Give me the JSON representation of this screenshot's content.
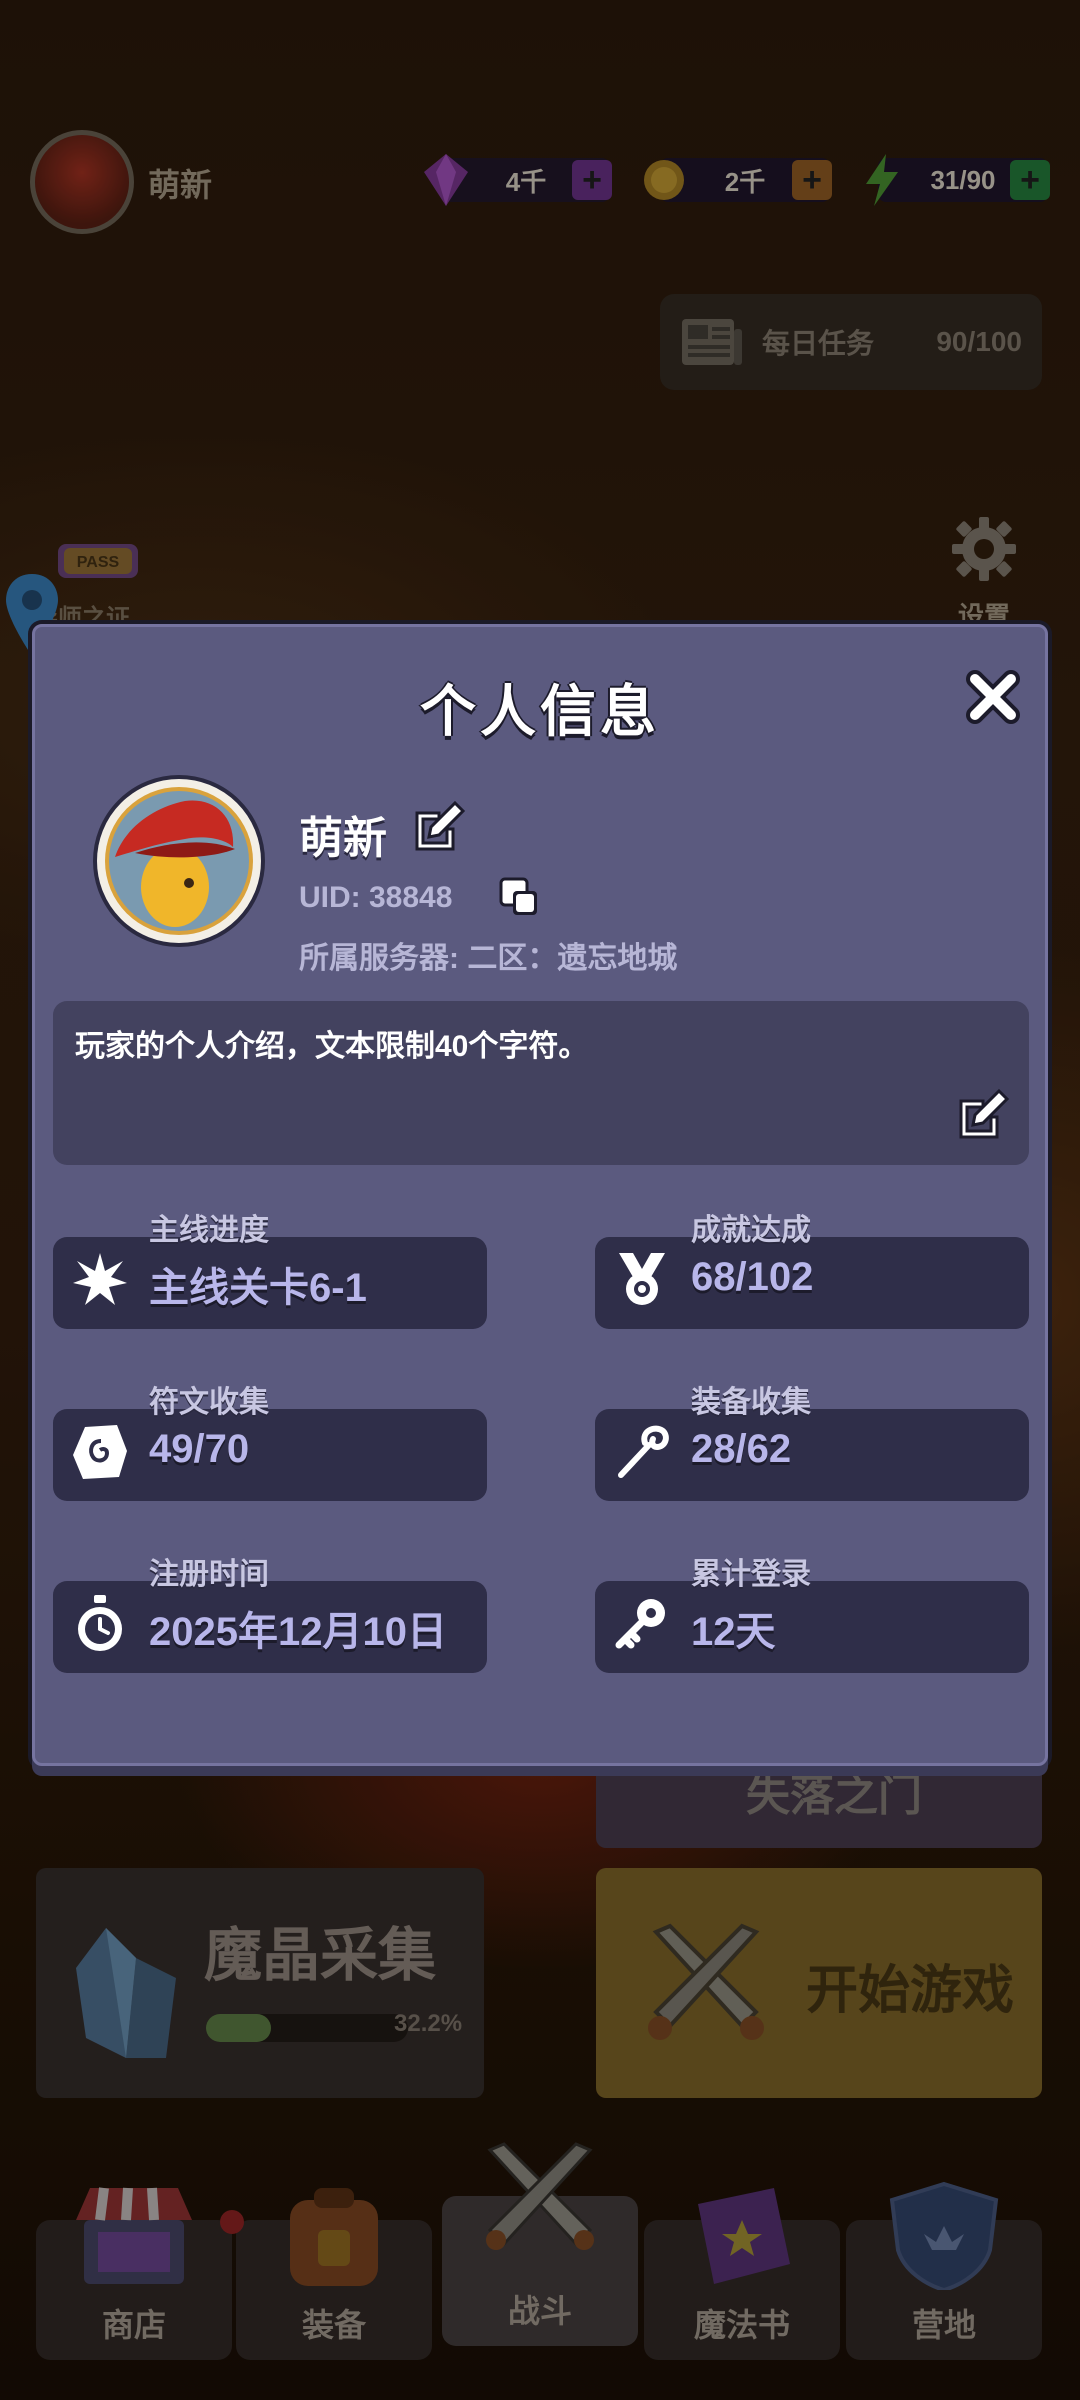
{
  "topbar": {
    "player_name": "萌新",
    "gems": "4千",
    "coins": "2千",
    "energy": "31/90",
    "daily_task_label": "每日任务",
    "daily_task_count": "90/100",
    "pass_badge": "PASS",
    "pass_label": "导师之证",
    "settings_label": "设置"
  },
  "background": {
    "lost_gate_label": "失落之门",
    "crystal_title": "魔晶采集",
    "crystal_progress_text": "32.2%",
    "crystal_progress": 0.322,
    "start_game_label": "开始游戏"
  },
  "nav": {
    "shop": "商店",
    "equipment": "装备",
    "battle": "战斗",
    "spellbook": "魔法书",
    "camp": "营地"
  },
  "modal": {
    "title": "个人信息",
    "player_name": "萌新",
    "uid": "UID: 38848",
    "server": "所属服务器: 二区：遗忘地城",
    "intro": "玩家的个人介绍，文本限制40个字符。",
    "stats": [
      {
        "label": "主线进度",
        "value": "主线关卡6-1",
        "icon": "star-burst-icon"
      },
      {
        "label": "成就达成",
        "value": "68/102",
        "icon": "medal-icon"
      },
      {
        "label": "符文收集",
        "value": "49/70",
        "icon": "rune-icon"
      },
      {
        "label": "装备收集",
        "value": "28/62",
        "icon": "staff-icon"
      },
      {
        "label": "注册时间",
        "value": "2025年12月10日",
        "icon": "stopwatch-icon"
      },
      {
        "label": "累计登录",
        "value": "12天",
        "icon": "key-icon"
      }
    ]
  },
  "colors": {
    "modal_bg": "#5b5a7f",
    "stat_box": "#2f2e49",
    "stat_value": "#b8b6ea",
    "gem_plus": "#a43fd8",
    "coin_plus": "#e08a2c",
    "energy_plus": "#2cb04a"
  }
}
